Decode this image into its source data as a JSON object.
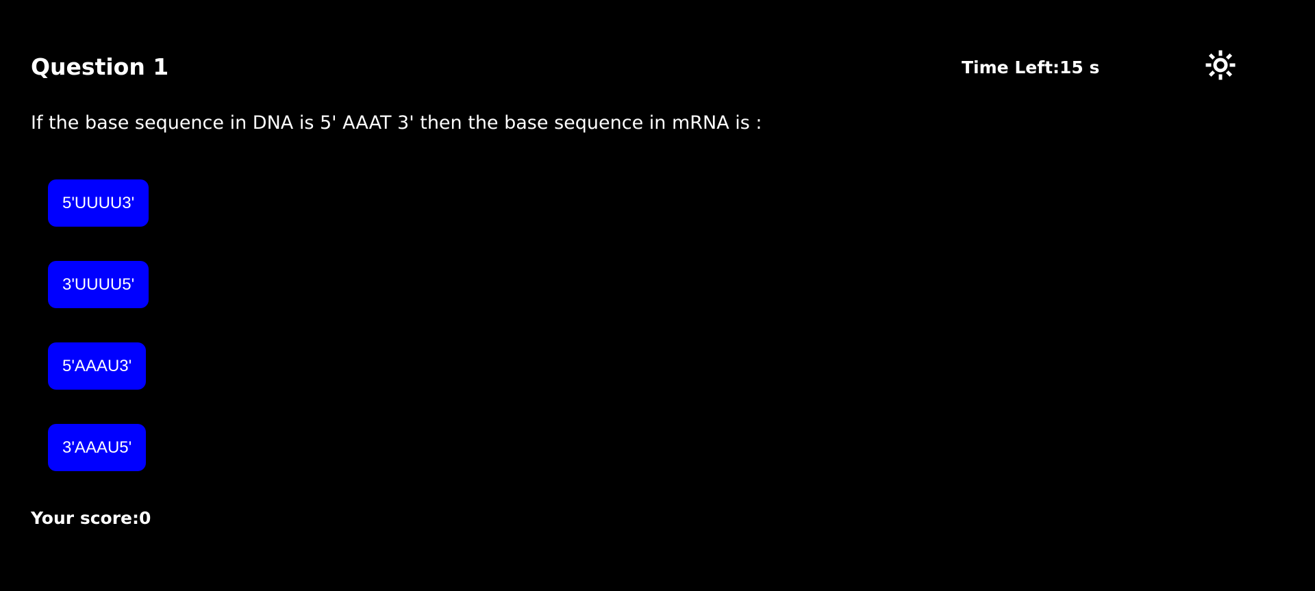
{
  "quiz": {
    "question_title": "Question 1",
    "timer_text": "Time Left:15 s",
    "question_text": "If the base sequence in DNA is 5' AAAT 3' then the base sequence in mRNA is :",
    "options": [
      {
        "label": "5'UUUU3'"
      },
      {
        "label": "3'UUUU5'"
      },
      {
        "label": "5'AAAU3'"
      },
      {
        "label": "3'AAAU5'"
      }
    ],
    "score_text": "Your score:0"
  },
  "icons": {
    "theme_toggle": "sun-icon"
  },
  "colors": {
    "background": "#000000",
    "text": "#ffffff",
    "option_button": "#0000ff"
  }
}
